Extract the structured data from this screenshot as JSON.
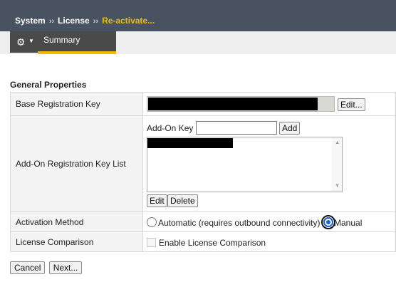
{
  "header": {
    "crumbs": [
      "System",
      "License"
    ],
    "separator": "››",
    "active_crumb": "Re-activate..."
  },
  "tabs": {
    "gear_icon": "gear-icon",
    "summary_label": "Summary"
  },
  "section": {
    "title": "General Properties"
  },
  "rows": {
    "base_key": {
      "label": "Base Registration Key",
      "edit_label": "Edit..."
    },
    "addon": {
      "label": "Add-On Registration Key List",
      "key_label": "Add-On Key",
      "key_value": "",
      "add_label": "Add",
      "edit_label": "Edit",
      "delete_label": "Delete"
    },
    "activation": {
      "label": "Activation Method",
      "automatic_label": "Automatic (requires outbound connectivity)",
      "manual_label": "Manual",
      "selected": "Manual"
    },
    "comparison": {
      "label": "License Comparison",
      "checkbox_label": "Enable License Comparison",
      "checked": false
    }
  },
  "footer": {
    "cancel_label": "Cancel",
    "next_label": "Next..."
  },
  "colors": {
    "header_bg": "#495261",
    "tab_bg": "#4a4a4a",
    "accent": "#f5b800",
    "radio_selected": "#1a5fd0"
  }
}
